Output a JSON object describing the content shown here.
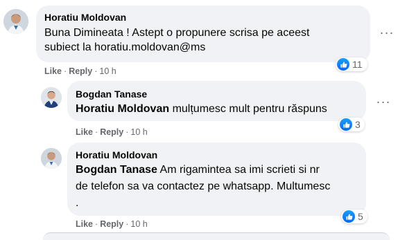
{
  "comments": [
    {
      "author": "Horatiu Moldovan",
      "text_line1": "Buna Dimineata ! Astept o propunere scrisa pe aceest",
      "text_line2": "subiect la horatiu.moldovan@ms",
      "like_label": "Like",
      "reply_label": "Reply",
      "time": "10 h",
      "reaction_count": "11"
    },
    {
      "author": "Bogdan Tanase",
      "tag": "Horatiu Moldovan",
      "text": "mulțumesc mult pentru răspuns",
      "like_label": "Like",
      "reply_label": "Reply",
      "time": "10 h",
      "reaction_count": "3"
    },
    {
      "author": "Horatiu Moldovan",
      "tag": "Bogdan Tanase",
      "text_line1": "Am rigamintea sa imi scrieti si nr",
      "text_line2": "de telefon sa va contactez pe whatsapp. Multumesc",
      "text_line3": ".",
      "like_label": "Like",
      "reply_label": "Reply",
      "time": "10 h",
      "reaction_count": "5"
    }
  ],
  "icons": {
    "reaction": "thumbs-up-icon",
    "more": "more-options-icon",
    "avatar": "profile-photo"
  },
  "colors": {
    "bubble": "#f0f2f5",
    "meta_text": "#65676b",
    "like_blue": "#0866ff"
  }
}
